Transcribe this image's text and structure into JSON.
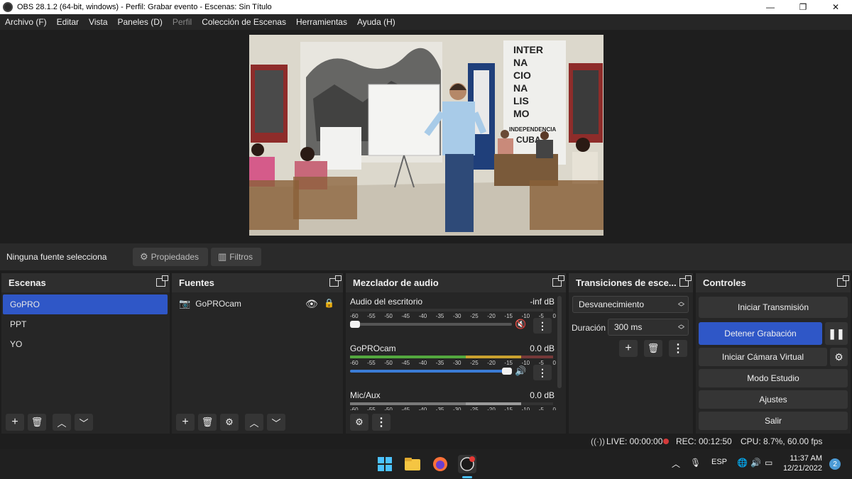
{
  "window": {
    "title": "OBS 28.1.2 (64-bit, windows) - Perfil: Grabar evento - Escenas: Sin Título",
    "minimize": "—",
    "maximize": "❐",
    "close": "✕"
  },
  "menu": {
    "items": [
      {
        "label": "Archivo (F)",
        "disabled": false
      },
      {
        "label": "Editar",
        "disabled": false
      },
      {
        "label": "Vista",
        "disabled": false
      },
      {
        "label": "Paneles (D)",
        "disabled": false
      },
      {
        "label": "Perfil",
        "disabled": true
      },
      {
        "label": "Colección de Escenas",
        "disabled": false
      },
      {
        "label": "Herramientas",
        "disabled": false
      },
      {
        "label": "Ayuda (H)",
        "disabled": false
      }
    ]
  },
  "preview": {
    "wall_lettering": [
      "INTER",
      "NA",
      "CIO",
      "NA",
      "LIS",
      "MO",
      "INDEPENDENCIA",
      "CUBA"
    ]
  },
  "source_toolbar": {
    "no_selection": "Ninguna fuente seleccionada",
    "properties_label": "Propiedades",
    "filters_label": "Filtros"
  },
  "scenes": {
    "title": "Escenas",
    "items": [
      {
        "label": "GoPRO",
        "selected": true
      },
      {
        "label": "PPT",
        "selected": false
      },
      {
        "label": "YO",
        "selected": false
      }
    ]
  },
  "sources": {
    "title": "Fuentes",
    "items": [
      {
        "label": "GoPROcam"
      }
    ]
  },
  "mixer": {
    "title": "Mezclador de audio",
    "scale": [
      "-60",
      "-55",
      "-50",
      "-45",
      "-40",
      "-35",
      "-30",
      "-25",
      "-20",
      "-15",
      "-10",
      "-5",
      "0"
    ],
    "channels": [
      {
        "name": "Audio del escritorio",
        "db": "-inf dB",
        "muted": true,
        "volume": 0.0
      },
      {
        "name": "GoPROcam",
        "db": "0.0 dB",
        "muted": false,
        "volume": 1.0
      },
      {
        "name": "Mic/Aux",
        "db": "0.0 dB",
        "muted": false,
        "volume": 1.0
      }
    ]
  },
  "transitions": {
    "title": "Transiciones de esce...",
    "selected": "Desvanecimiento",
    "duration_label": "Duración",
    "duration_value": "300 ms"
  },
  "controls": {
    "title": "Controles",
    "start_stream": "Iniciar Transmisión",
    "stop_recording": "Detener Grabación",
    "virtual_cam": "Iniciar Cámara Virtual",
    "studio_mode": "Modo Estudio",
    "settings": "Ajustes",
    "exit": "Salir"
  },
  "status": {
    "live": "LIVE: 00:00:00",
    "rec": "REC: 00:12:50",
    "cpu": "CPU: 8.7%, 60.00 fps"
  },
  "taskbar": {
    "lang": "ESP",
    "time": "11:37 AM",
    "date": "12/21/2022",
    "notifications": "2"
  },
  "colors": {
    "accent": "#2f57c7",
    "rec_dot": "#d33a3a"
  }
}
